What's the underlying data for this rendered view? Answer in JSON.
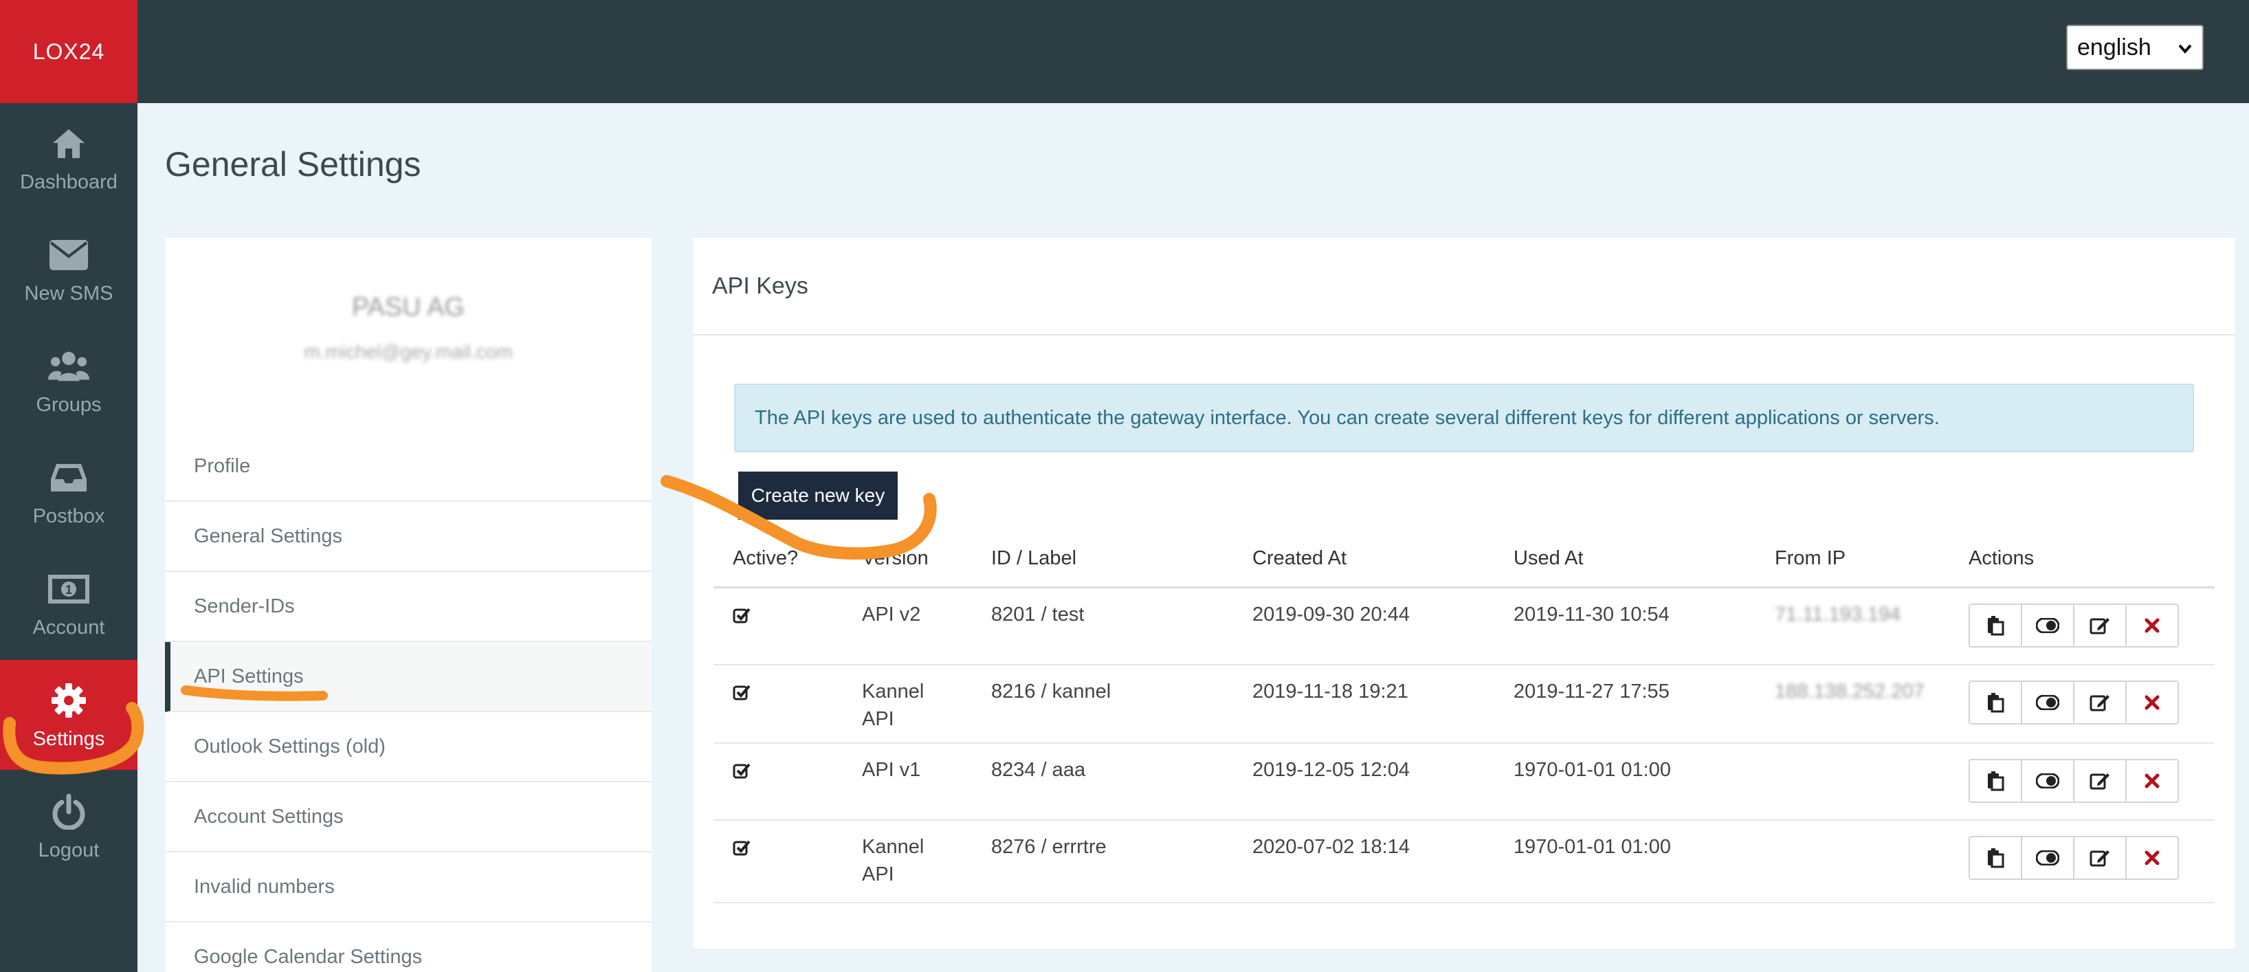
{
  "app": {
    "logo_text": "LOX24",
    "brand_color": "#d0202a",
    "sidebar_color": "#2c3e43"
  },
  "language": {
    "selected": "english"
  },
  "nav": {
    "items": [
      {
        "label": "Dashboard",
        "icon": "home-icon"
      },
      {
        "label": "New SMS",
        "icon": "envelope-icon"
      },
      {
        "label": "Groups",
        "icon": "users-icon"
      },
      {
        "label": "Postbox",
        "icon": "inbox-icon"
      },
      {
        "label": "Account",
        "icon": "money-icon"
      },
      {
        "label": "Settings",
        "icon": "gear-icon",
        "active": true
      },
      {
        "label": "Logout",
        "icon": "power-icon"
      }
    ]
  },
  "page": {
    "title": "General Settings"
  },
  "profile": {
    "name": "PASU AG",
    "email": "m.michel@gey.mail.com"
  },
  "settings_menu": {
    "items": [
      {
        "label": "Profile"
      },
      {
        "label": "General Settings"
      },
      {
        "label": "Sender-IDs"
      },
      {
        "label": "API Settings",
        "active": true
      },
      {
        "label": "Outlook Settings (old)"
      },
      {
        "label": "Account Settings"
      },
      {
        "label": "Invalid numbers"
      },
      {
        "label": "Google Calendar Settings"
      }
    ]
  },
  "api_keys": {
    "title": "API Keys",
    "info": "The API keys are used to authenticate the gateway interface. You can create several different keys for different applications or servers.",
    "create_button": "Create new key",
    "columns": [
      "Active?",
      "Version",
      "ID / Label",
      "Created At",
      "Used At",
      "From IP",
      "Actions"
    ],
    "rows": [
      {
        "active": true,
        "version": [
          "API v2"
        ],
        "id_label": "8201 / test",
        "created": "2019-09-30 20:44",
        "used": "2019-11-30 10:54",
        "ip": "71.11.193.194"
      },
      {
        "active": true,
        "version": [
          "Kannel",
          "API"
        ],
        "id_label": "8216 / kannel",
        "created": "2019-11-18 19:21",
        "used": "2019-11-27 17:55",
        "ip": "188.138.252.207"
      },
      {
        "active": true,
        "version": [
          "API v1"
        ],
        "id_label": "8234 / aaa",
        "created": "2019-12-05 12:04",
        "used": "1970-01-01 01:00",
        "ip": ""
      },
      {
        "active": true,
        "version": [
          "Kannel",
          "API"
        ],
        "id_label": "8276 / errrtre",
        "created": "2020-07-02 18:14",
        "used": "1970-01-01 01:00",
        "ip": ""
      }
    ],
    "row_actions": [
      {
        "name": "copy-key-button",
        "icon": "clipboard-icon"
      },
      {
        "name": "toggle-active-button",
        "icon": "toggle-icon"
      },
      {
        "name": "edit-key-button",
        "icon": "edit-icon"
      },
      {
        "name": "delete-key-button",
        "icon": "close-icon"
      }
    ]
  }
}
